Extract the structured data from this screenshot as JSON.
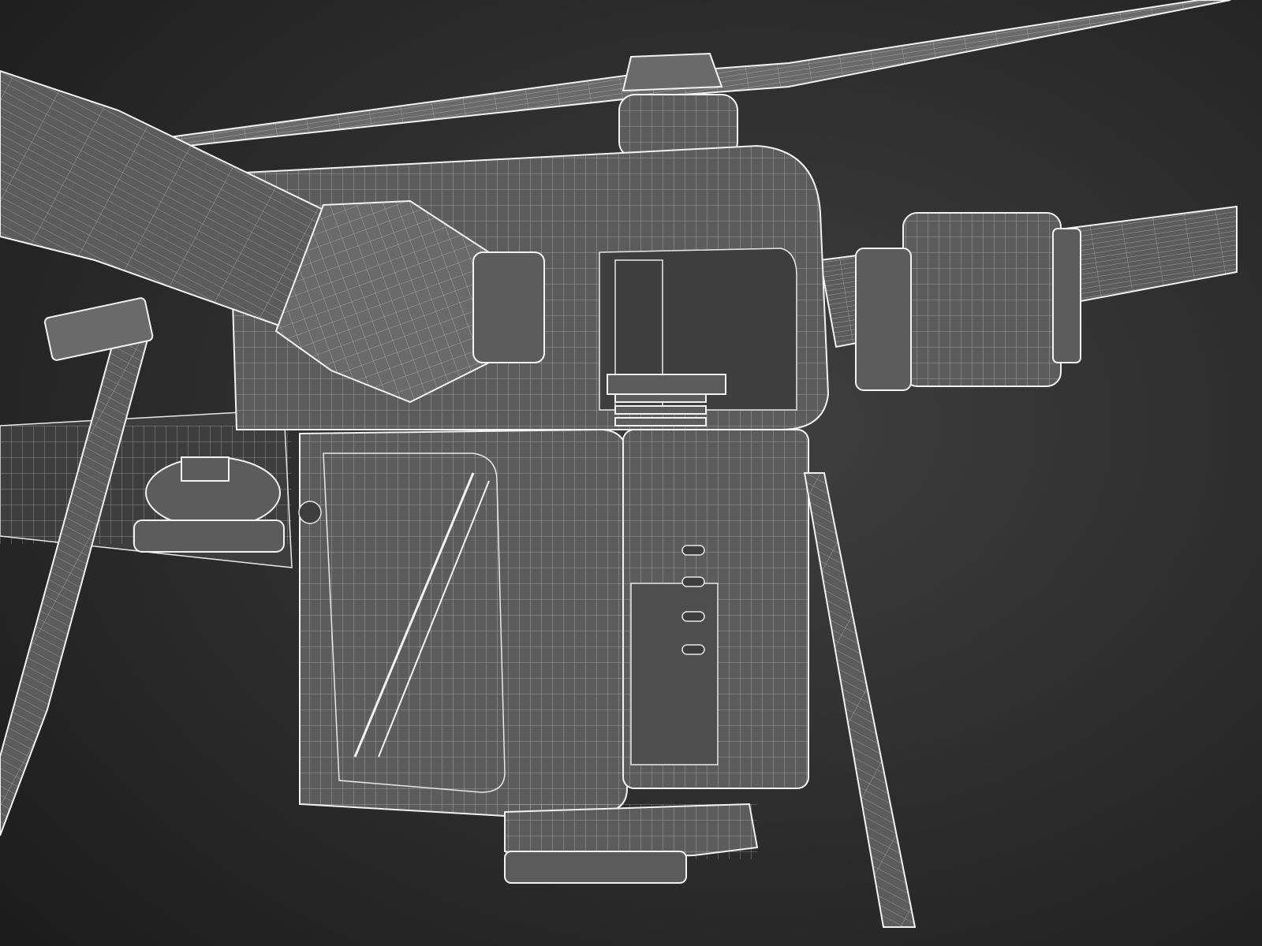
{
  "scene": {
    "subject": "drone-wireframe-render",
    "colors": {
      "background_center": "#3f3f3f",
      "background_edge": "#1c1c1c",
      "surface": "#5c5c5c",
      "wireframe": "#f2f2f2"
    }
  }
}
